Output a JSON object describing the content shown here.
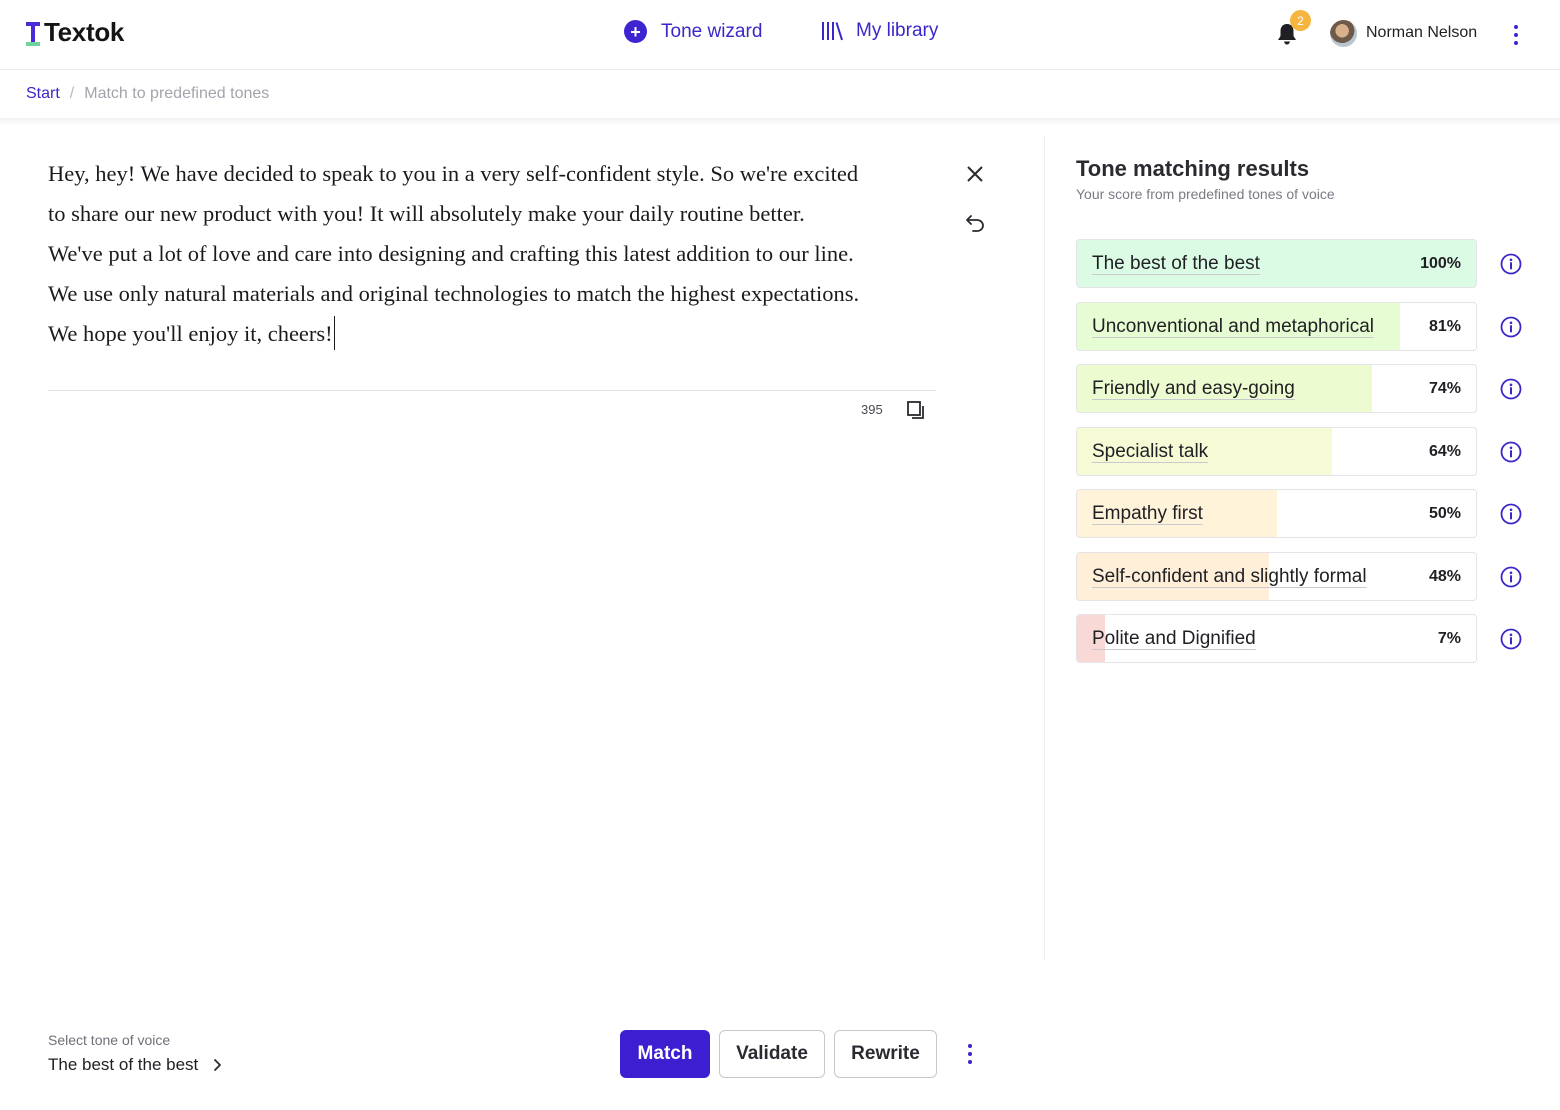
{
  "header": {
    "logo_text": "Textok",
    "nav": [
      {
        "label": "Tone wizard",
        "icon": "plus-circle-icon"
      },
      {
        "label": "My library",
        "icon": "library-icon"
      }
    ],
    "notifications_count": "2",
    "user_name": "Norman Nelson"
  },
  "breadcrumb": {
    "start": "Start",
    "separator": "/",
    "current": "Match to predefined tones"
  },
  "editor": {
    "lines": [
      "Hey, hey! We have decided to speak to you in a very self-confident style. So we're excited",
      "to  share our new product with you! It will absolutely make your daily routine better.",
      "We've put a lot of love and care into designing and crafting this latest addition to our line.",
      "We use only natural materials and original technologies to match the highest expectations.",
      "We hope you'll enjoy it, cheers!"
    ],
    "char_count": "395"
  },
  "results": {
    "title": "Tone matching results",
    "subtitle": "Your score from predefined tones of voice",
    "items": [
      {
        "label": "The best of the best",
        "percent": "100%",
        "value": 100,
        "color": "#dcfbe5"
      },
      {
        "label": "Unconventional and metaphorical",
        "percent": "81%",
        "value": 81,
        "color": "#e6fcd2"
      },
      {
        "label": "Friendly and easy-going",
        "percent": "74%",
        "value": 74,
        "color": "#edfcd0"
      },
      {
        "label": "Specialist talk",
        "percent": "64%",
        "value": 64,
        "color": "#f6fbd6"
      },
      {
        "label": "Empathy first",
        "percent": "50%",
        "value": 50,
        "color": "#fff3da"
      },
      {
        "label": "Self-confident and slightly formal",
        "percent": "48%",
        "value": 48,
        "color": "#ffefd9"
      },
      {
        "label": "Polite and Dignified",
        "percent": "7%",
        "value": 7,
        "color": "#f8d9d6"
      }
    ]
  },
  "footer": {
    "select_label": "Select tone of voice",
    "selected_tone": "The best of the best",
    "buttons": {
      "match": "Match",
      "validate": "Validate",
      "rewrite": "Rewrite"
    }
  },
  "colors": {
    "accent": "#3d1fd1",
    "badge": "#f5b53f",
    "logo_green": "#6fd49a"
  }
}
